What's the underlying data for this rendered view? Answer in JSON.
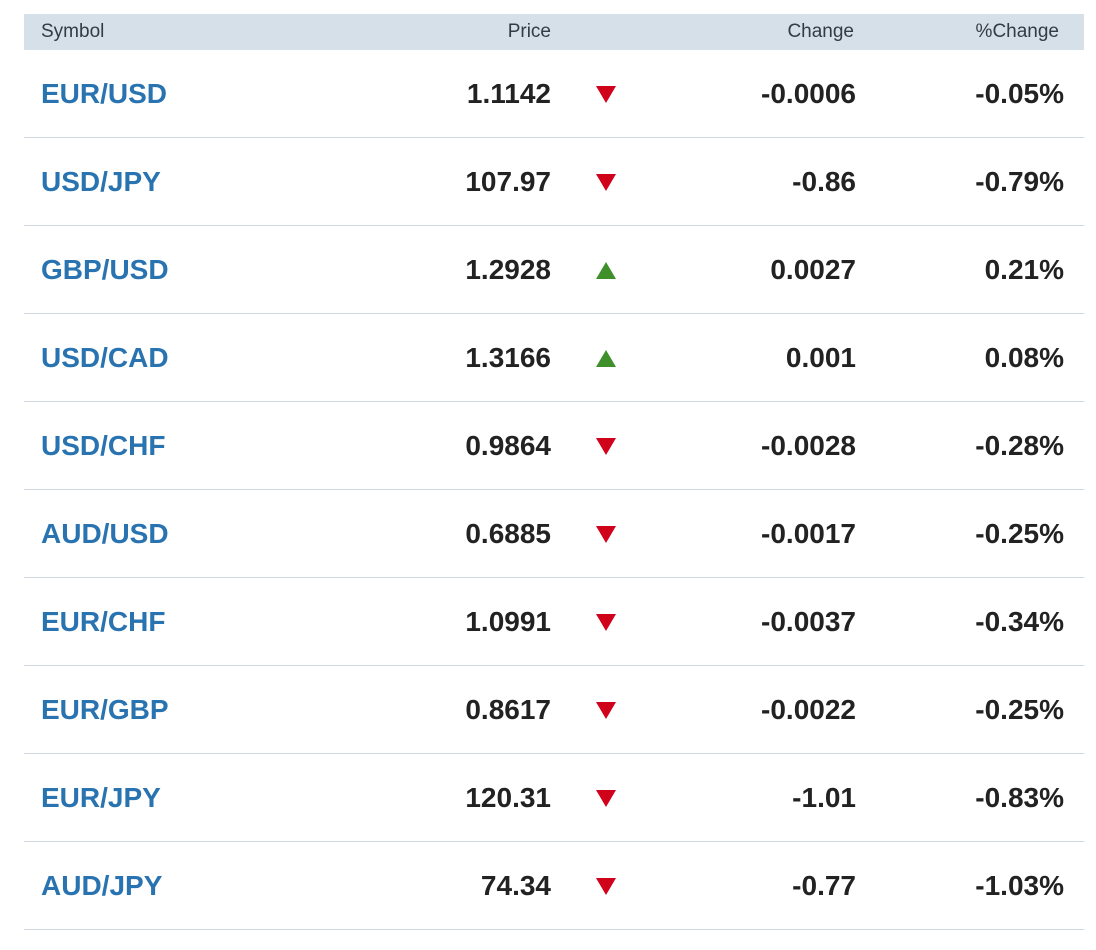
{
  "header": {
    "symbol": "Symbol",
    "price": "Price",
    "change": "Change",
    "pct_change": "%Change"
  },
  "rows": [
    {
      "symbol": "EUR/USD",
      "price": "1.1142",
      "direction": "down",
      "change": "-0.0006",
      "pct_change": "-0.05%"
    },
    {
      "symbol": "USD/JPY",
      "price": "107.97",
      "direction": "down",
      "change": "-0.86",
      "pct_change": "-0.79%"
    },
    {
      "symbol": "GBP/USD",
      "price": "1.2928",
      "direction": "up",
      "change": "0.0027",
      "pct_change": "0.21%"
    },
    {
      "symbol": "USD/CAD",
      "price": "1.3166",
      "direction": "up",
      "change": "0.001",
      "pct_change": "0.08%"
    },
    {
      "symbol": "USD/CHF",
      "price": "0.9864",
      "direction": "down",
      "change": "-0.0028",
      "pct_change": "-0.28%"
    },
    {
      "symbol": "AUD/USD",
      "price": "0.6885",
      "direction": "down",
      "change": "-0.0017",
      "pct_change": "-0.25%"
    },
    {
      "symbol": "EUR/CHF",
      "price": "1.0991",
      "direction": "down",
      "change": "-0.0037",
      "pct_change": "-0.34%"
    },
    {
      "symbol": "EUR/GBP",
      "price": "0.8617",
      "direction": "down",
      "change": "-0.0022",
      "pct_change": "-0.25%"
    },
    {
      "symbol": "EUR/JPY",
      "price": "120.31",
      "direction": "down",
      "change": "-1.01",
      "pct_change": "-0.83%"
    },
    {
      "symbol": "AUD/JPY",
      "price": "74.34",
      "direction": "down",
      "change": "-0.77",
      "pct_change": "-1.03%"
    }
  ],
  "colors": {
    "link": "#2873b0",
    "header_bg": "#d6e0e9",
    "down": "#d0021b",
    "up": "#3f8f2b"
  },
  "icons": {
    "down": "triangle-down-icon",
    "up": "triangle-up-icon"
  }
}
